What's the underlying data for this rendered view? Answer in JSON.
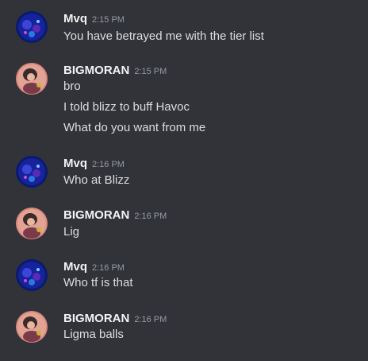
{
  "messages": [
    {
      "author": "Mvq",
      "time": "2:15 PM",
      "avatar_icon": "mvq-avatar",
      "lines": [
        "You have betrayed me with the tier list"
      ]
    },
    {
      "author": "BIGMORAN",
      "time": "2:15 PM",
      "avatar_icon": "bigmoran-avatar",
      "lines": [
        "bro",
        "I told blizz to buff Havoc",
        "What do you want from me"
      ]
    },
    {
      "author": "Mvq",
      "time": "2:16 PM",
      "avatar_icon": "mvq-avatar",
      "lines": [
        "Who at Blizz"
      ]
    },
    {
      "author": "BIGMORAN",
      "time": "2:16 PM",
      "avatar_icon": "bigmoran-avatar",
      "lines": [
        "Lig"
      ]
    },
    {
      "author": "Mvq",
      "time": "2:16 PM",
      "avatar_icon": "mvq-avatar",
      "lines": [
        "Who tf is that"
      ]
    },
    {
      "author": "BIGMORAN",
      "time": "2:16 PM",
      "avatar_icon": "bigmoran-avatar",
      "lines": [
        "Ligma balls"
      ]
    }
  ],
  "colors": {
    "background": "#313338",
    "username": "#f2f3f5",
    "timestamp": "#949ba4",
    "message_text": "#dbdee1"
  }
}
